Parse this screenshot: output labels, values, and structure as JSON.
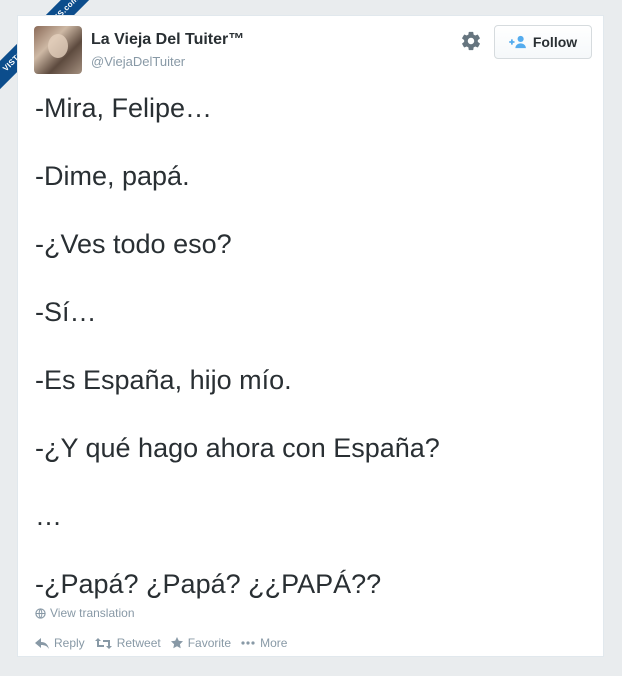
{
  "watermark": {
    "text": "VISTOENLASREDES.com"
  },
  "tweet": {
    "author": {
      "name": "La Vieja Del Tuiter™",
      "handle": "@ViejaDelTuiter"
    },
    "follow_label": "Follow",
    "lines": [
      "-Mira, Felipe…",
      "-Dime, papá.",
      "-¿Ves todo eso?",
      "-Sí…",
      "-Es España, hijo mío.",
      "-¿Y qué hago ahora con España?",
      "…",
      "-¿Papá? ¿Papá? ¿¿PAPÁ??"
    ],
    "translation_label": "View translation",
    "actions": {
      "reply": "Reply",
      "retweet": "Retweet",
      "favorite": "Favorite",
      "more": "More"
    }
  },
  "icons": {
    "settings": "gear-icon",
    "follow": "follow-user-icon",
    "translate": "globe-icon",
    "reply": "reply-icon",
    "retweet": "retweet-icon",
    "favorite": "star-icon",
    "more": "ellipsis-icon"
  },
  "colors": {
    "background": "#e9ecee",
    "card": "#ffffff",
    "text": "#292f33",
    "muted": "#8899a6",
    "accent": "#55acee",
    "ribbon": "#0c4d8c"
  }
}
